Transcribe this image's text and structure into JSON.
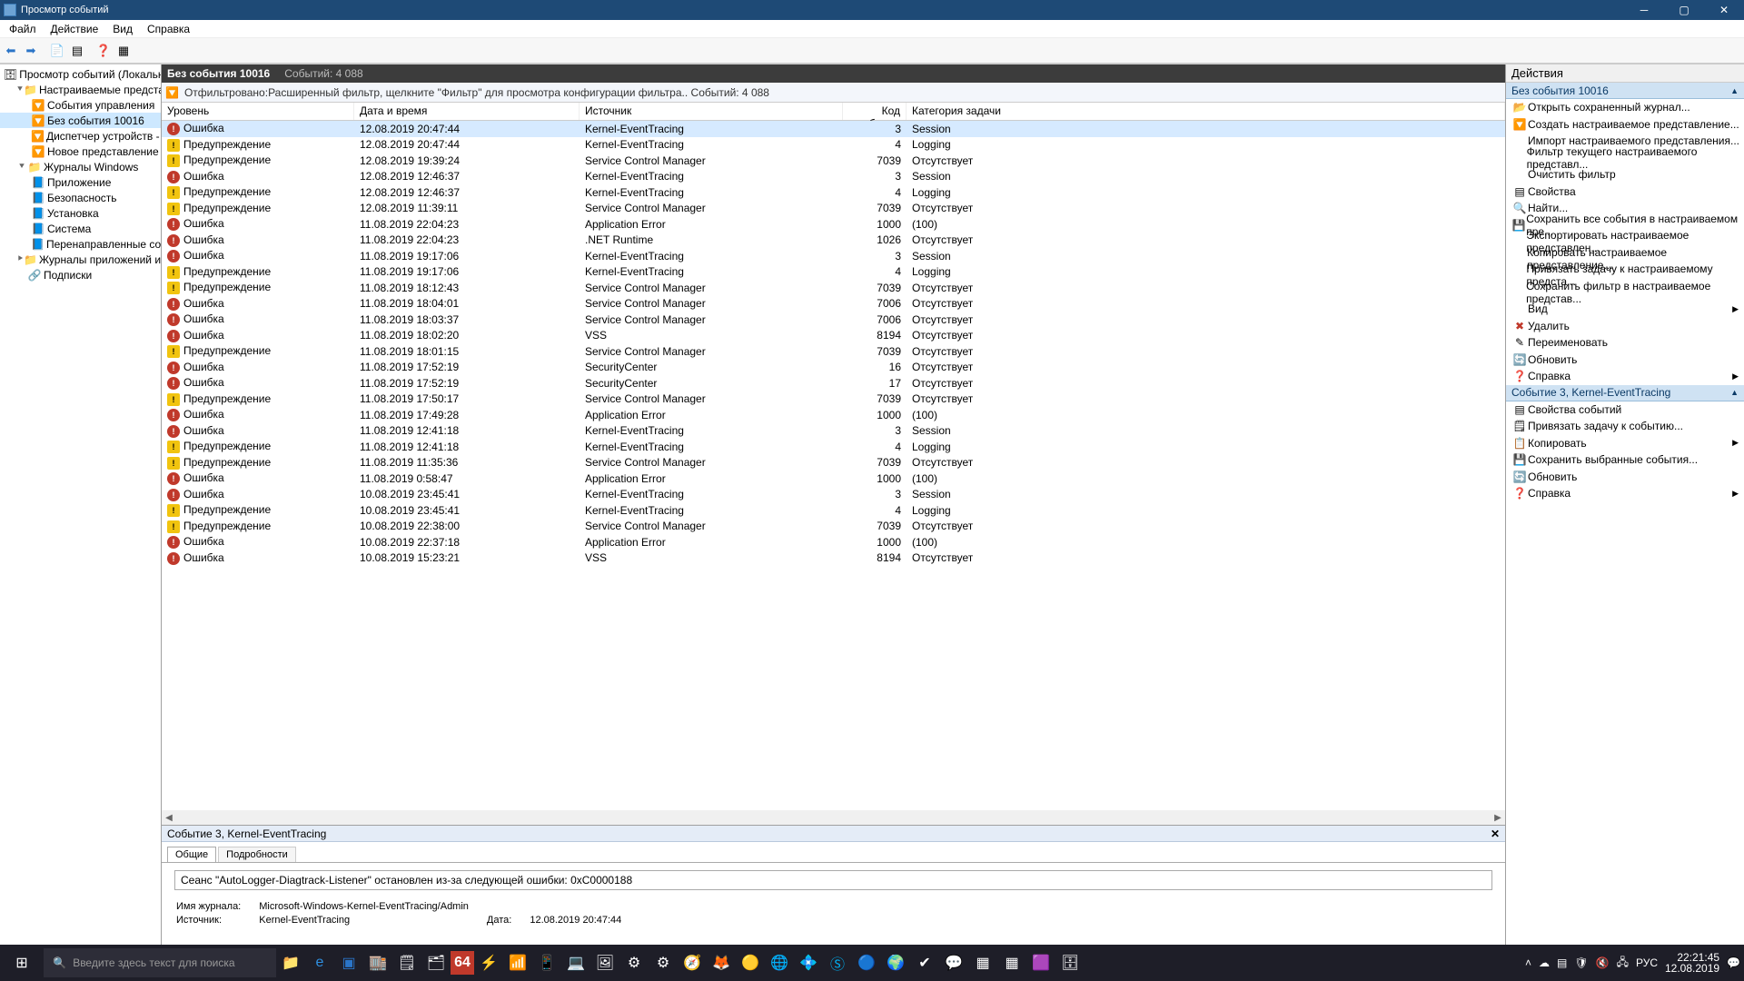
{
  "window": {
    "title": "Просмотр событий"
  },
  "menu": [
    "Файл",
    "Действие",
    "Вид",
    "Справка"
  ],
  "tree": {
    "root": "Просмотр событий (Локальный)",
    "custom_views": "Настраиваемые представления",
    "cv_items": [
      "События управления",
      "Без события 10016",
      "Диспетчер устройств - V",
      "Новое представление"
    ],
    "win_logs": "Журналы Windows",
    "wl_items": [
      "Приложение",
      "Безопасность",
      "Установка",
      "Система",
      "Перенаправленные события"
    ],
    "app_svc": "Журналы приложений и служб",
    "subs": "Подписки"
  },
  "header": {
    "title": "Без события 10016",
    "count_label": "Событий: 4 088"
  },
  "filter_text": "Отфильтровано:Расширенный фильтр, щелкните \"Фильтр\" для просмотра конфигурации фильтра.. Событий: 4 088",
  "columns": {
    "level": "Уровень",
    "date": "Дата и время",
    "src": "Источник",
    "code": "Код события",
    "cat": "Категория задачи"
  },
  "levels": {
    "err": "Ошибка",
    "warn": "Предупреждение"
  },
  "rows": [
    {
      "l": "err",
      "d": "12.08.2019 20:47:44",
      "s": "Kernel-EventTracing",
      "c": 3,
      "t": "Session",
      "sel": true
    },
    {
      "l": "warn",
      "d": "12.08.2019 20:47:44",
      "s": "Kernel-EventTracing",
      "c": 4,
      "t": "Logging"
    },
    {
      "l": "warn",
      "d": "12.08.2019 19:39:24",
      "s": "Service Control Manager",
      "c": 7039,
      "t": "Отсутствует"
    },
    {
      "l": "err",
      "d": "12.08.2019 12:46:37",
      "s": "Kernel-EventTracing",
      "c": 3,
      "t": "Session"
    },
    {
      "l": "warn",
      "d": "12.08.2019 12:46:37",
      "s": "Kernel-EventTracing",
      "c": 4,
      "t": "Logging"
    },
    {
      "l": "warn",
      "d": "12.08.2019 11:39:11",
      "s": "Service Control Manager",
      "c": 7039,
      "t": "Отсутствует"
    },
    {
      "l": "err",
      "d": "11.08.2019 22:04:23",
      "s": "Application Error",
      "c": 1000,
      "t": "(100)"
    },
    {
      "l": "err",
      "d": "11.08.2019 22:04:23",
      "s": ".NET Runtime",
      "c": 1026,
      "t": "Отсутствует"
    },
    {
      "l": "err",
      "d": "11.08.2019 19:17:06",
      "s": "Kernel-EventTracing",
      "c": 3,
      "t": "Session"
    },
    {
      "l": "warn",
      "d": "11.08.2019 19:17:06",
      "s": "Kernel-EventTracing",
      "c": 4,
      "t": "Logging"
    },
    {
      "l": "warn",
      "d": "11.08.2019 18:12:43",
      "s": "Service Control Manager",
      "c": 7039,
      "t": "Отсутствует"
    },
    {
      "l": "err",
      "d": "11.08.2019 18:04:01",
      "s": "Service Control Manager",
      "c": 7006,
      "t": "Отсутствует"
    },
    {
      "l": "err",
      "d": "11.08.2019 18:03:37",
      "s": "Service Control Manager",
      "c": 7006,
      "t": "Отсутствует"
    },
    {
      "l": "err",
      "d": "11.08.2019 18:02:20",
      "s": "VSS",
      "c": 8194,
      "t": "Отсутствует"
    },
    {
      "l": "warn",
      "d": "11.08.2019 18:01:15",
      "s": "Service Control Manager",
      "c": 7039,
      "t": "Отсутствует"
    },
    {
      "l": "err",
      "d": "11.08.2019 17:52:19",
      "s": "SecurityCenter",
      "c": 16,
      "t": "Отсутствует"
    },
    {
      "l": "err",
      "d": "11.08.2019 17:52:19",
      "s": "SecurityCenter",
      "c": 17,
      "t": "Отсутствует"
    },
    {
      "l": "warn",
      "d": "11.08.2019 17:50:17",
      "s": "Service Control Manager",
      "c": 7039,
      "t": "Отсутствует"
    },
    {
      "l": "err",
      "d": "11.08.2019 17:49:28",
      "s": "Application Error",
      "c": 1000,
      "t": "(100)"
    },
    {
      "l": "err",
      "d": "11.08.2019 12:41:18",
      "s": "Kernel-EventTracing",
      "c": 3,
      "t": "Session"
    },
    {
      "l": "warn",
      "d": "11.08.2019 12:41:18",
      "s": "Kernel-EventTracing",
      "c": 4,
      "t": "Logging"
    },
    {
      "l": "warn",
      "d": "11.08.2019 11:35:36",
      "s": "Service Control Manager",
      "c": 7039,
      "t": "Отсутствует"
    },
    {
      "l": "err",
      "d": "11.08.2019 0:58:47",
      "s": "Application Error",
      "c": 1000,
      "t": "(100)"
    },
    {
      "l": "err",
      "d": "10.08.2019 23:45:41",
      "s": "Kernel-EventTracing",
      "c": 3,
      "t": "Session"
    },
    {
      "l": "warn",
      "d": "10.08.2019 23:45:41",
      "s": "Kernel-EventTracing",
      "c": 4,
      "t": "Logging"
    },
    {
      "l": "warn",
      "d": "10.08.2019 22:38:00",
      "s": "Service Control Manager",
      "c": 7039,
      "t": "Отсутствует"
    },
    {
      "l": "err",
      "d": "10.08.2019 22:37:18",
      "s": "Application Error",
      "c": 1000,
      "t": "(100)"
    },
    {
      "l": "err",
      "d": "10.08.2019 15:23:21",
      "s": "VSS",
      "c": 8194,
      "t": "Отсутствует"
    }
  ],
  "detail": {
    "title": "Событие 3, Kernel-EventTracing",
    "tabs": {
      "general": "Общие",
      "details": "Подробности"
    },
    "message": "Сеанс \"AutoLogger-Diagtrack-Listener\" остановлен из-за следующей ошибки: 0xC0000188",
    "log_name_label": "Имя журнала:",
    "log_name": "Microsoft-Windows-Kernel-EventTracing/Admin",
    "source_label": "Источник:",
    "source": "Kernel-EventTracing",
    "date_label": "Дата:",
    "date": "12.08.2019 20:47:44"
  },
  "actions": {
    "title": "Действия",
    "group1_title": "Без события 10016",
    "group1": [
      {
        "i": "📂",
        "t": "Открыть сохраненный журнал..."
      },
      {
        "i": "🔽",
        "t": "Создать настраиваемое представление..."
      },
      {
        "i": " ",
        "t": "Импорт настраиваемого представления..."
      },
      {
        "i": " ",
        "t": "Фильтр текущего настраиваемого представл..."
      },
      {
        "i": " ",
        "t": "Очистить фильтр"
      },
      {
        "i": "▤",
        "t": "Свойства"
      },
      {
        "i": "🔍",
        "t": "Найти..."
      },
      {
        "i": "💾",
        "t": "Сохранить все события в настраиваемом пре..."
      },
      {
        "i": " ",
        "t": "Экспортировать настраиваемое представлен..."
      },
      {
        "i": " ",
        "t": "Копировать настраиваемое представление..."
      },
      {
        "i": " ",
        "t": "Привязать задачу к настраиваемому предста..."
      },
      {
        "i": " ",
        "t": "Сохранить фильтр в настраиваемое представ..."
      },
      {
        "i": " ",
        "t": "Вид",
        "sub": true
      },
      {
        "i": "✖",
        "t": "Удалить",
        "red": true
      },
      {
        "i": "✎",
        "t": "Переименовать"
      },
      {
        "i": "🔄",
        "t": "Обновить"
      },
      {
        "i": "❓",
        "t": "Справка",
        "sub": true
      }
    ],
    "group2_title": "Событие 3, Kernel-EventTracing",
    "group2": [
      {
        "i": "▤",
        "t": "Свойства событий"
      },
      {
        "i": "🗒",
        "t": "Привязать задачу к событию..."
      },
      {
        "i": "📋",
        "t": "Копировать",
        "sub": true
      },
      {
        "i": "💾",
        "t": "Сохранить выбранные события..."
      },
      {
        "i": "🔄",
        "t": "Обновить"
      },
      {
        "i": "❓",
        "t": "Справка",
        "sub": true
      }
    ]
  },
  "taskbar": {
    "search_placeholder": "Введите здесь текст для поиска",
    "clock_time": "22:21:45",
    "clock_date": "12.08.2019",
    "lang": "РУС"
  }
}
